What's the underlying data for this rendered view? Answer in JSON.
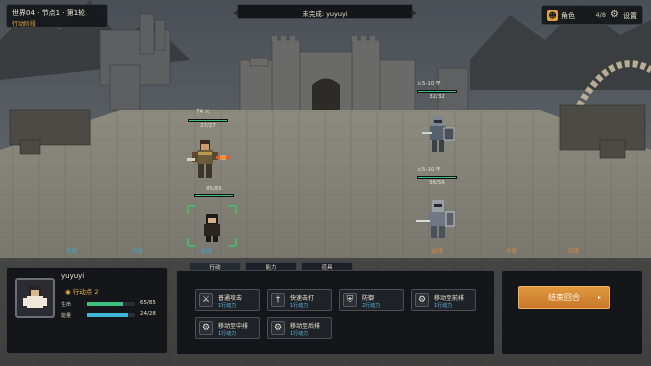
{
  "hud": {
    "world_line": "世界04 · 节点1 · 第1轮",
    "phase": "行动阶段",
    "banner": "未完成: yuyuyi",
    "role_label": "角色",
    "role_count": "4/8",
    "settings_label": "设置"
  },
  "units": {
    "ally_top": {
      "label": "74 ⚔",
      "hp": "27/27",
      "hp_fraction": 1.0
    },
    "ally_mid": {
      "hp": "85/85",
      "hp_fraction": 1.0
    },
    "ally_bottom": {
      "label": "前排"
    },
    "enemy_top": {
      "label": "⚔5-10 ⛨",
      "hp": "32/32",
      "hp_fraction": 1.0
    },
    "enemy_bottom": {
      "label": "⚔5-10 ⛨",
      "hp": "56/56",
      "hp_fraction": 1.0
    }
  },
  "lanes": [
    "后排",
    "中排",
    "前排",
    "前排",
    "中排",
    "后排"
  ],
  "lane_colors": {
    "ally": "#3ea7c9",
    "enemy": "#e08a3c"
  },
  "character": {
    "name": "yuyuyi",
    "action_points": "行动点 2",
    "hp_label": "生命",
    "hp_value": "65/85",
    "hp_fraction": 0.76,
    "shield_label": "能量",
    "shield_value": "24/28",
    "shield_fraction": 0.86
  },
  "tabs": [
    "行动",
    "能力",
    "道具"
  ],
  "skills": [
    {
      "name": "普通攻击",
      "cost": "1行动力",
      "icon": "sword-icon"
    },
    {
      "name": "快速击打",
      "cost": "1行动力",
      "icon": "dagger-icon"
    },
    {
      "name": "防御",
      "cost": "2行动力",
      "icon": "shield-icon"
    },
    {
      "name": "移动至前排",
      "cost": "1行动力",
      "icon": "move-icon"
    },
    {
      "name": "移动至中排",
      "cost": "1行动力",
      "icon": "move-icon"
    },
    {
      "name": "移动至后排",
      "cost": "1行动力",
      "icon": "move-icon"
    }
  ],
  "end_turn": {
    "label": "结束回合",
    "arrow": "▸"
  },
  "colors": {
    "accent": "#d9a441",
    "hp_green": "#3fbf7f",
    "energy_blue": "#3fb6d6",
    "end_turn_orange": "#d9873a"
  }
}
